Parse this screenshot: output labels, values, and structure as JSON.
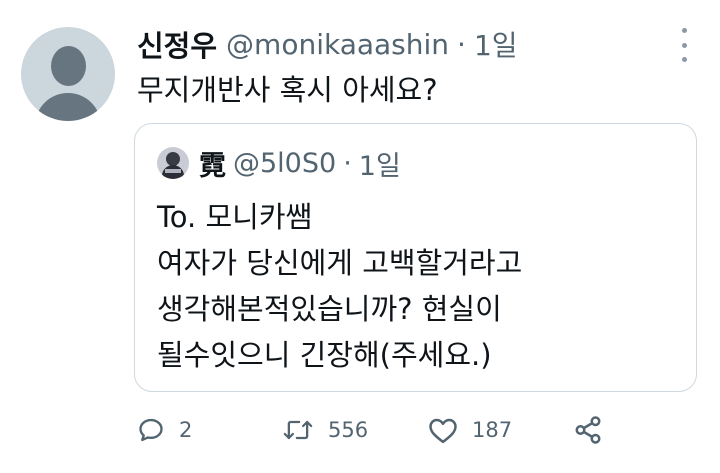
{
  "tweet": {
    "display_name": "신정우",
    "handle": "@monikaaashin",
    "separator": "·",
    "time": "1일",
    "text": "무지개반사 혹시 아세요?"
  },
  "quoted": {
    "display_name": "霓",
    "handle": "@5l0S0",
    "separator": "·",
    "time": "1일",
    "lines": [
      "To. 모니카쌤",
      "여자가 당신에게 고백할거라고",
      "생각해본적있습니까? 현실이",
      "될수잇으니 긴장해(주세요.)"
    ]
  },
  "actions": {
    "reply_count": "2",
    "retweet_count": "556",
    "like_count": "187"
  },
  "icons": {
    "more": "more-vertical-icon",
    "reply": "reply-icon",
    "retweet": "retweet-icon",
    "like": "heart-icon",
    "share": "share-icon"
  },
  "colors": {
    "text": "#0f1419",
    "secondary": "#536471",
    "border": "#cfd9de"
  }
}
